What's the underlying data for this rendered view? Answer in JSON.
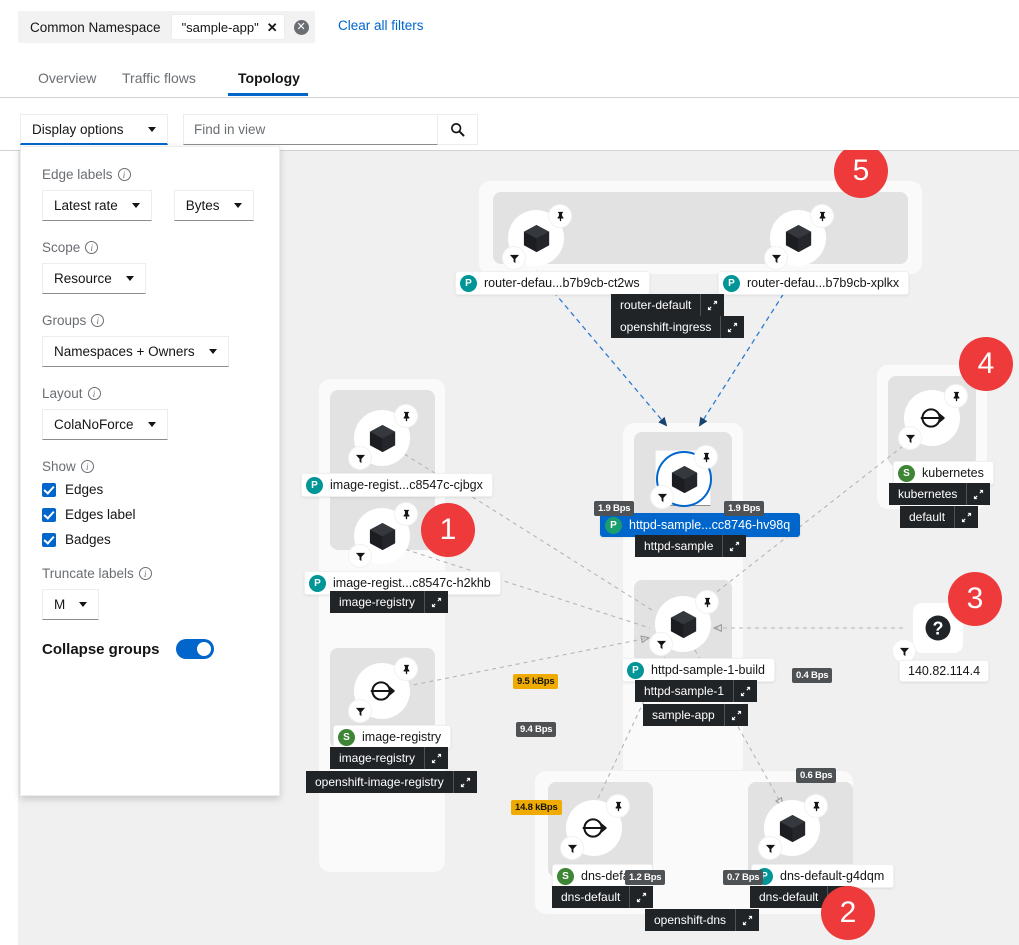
{
  "filterbar": {
    "category": "Common Namespace",
    "value": "\"sample-app\"",
    "remove_icon": "✕",
    "clear_chip_icon": "✕",
    "clear_all_label": "Clear all filters"
  },
  "tabs": [
    {
      "label": "Overview",
      "active": false
    },
    {
      "label": "Traffic flows",
      "active": false
    },
    {
      "label": "Topology",
      "active": true
    }
  ],
  "toolbar": {
    "display_options_label": "Display options",
    "search_placeholder": "Find in view",
    "search_value": "",
    "search_icon": "search-icon"
  },
  "display_panel": {
    "edge_labels": {
      "title": "Edge labels",
      "metric_select": "Latest rate",
      "unit_select": "Bytes"
    },
    "scope": {
      "title": "Scope",
      "select": "Resource"
    },
    "groups": {
      "title": "Groups",
      "select": "Namespaces + Owners"
    },
    "layout": {
      "title": "Layout",
      "select": "ColaNoForce"
    },
    "show": {
      "title": "Show",
      "items": [
        {
          "label": "Edges",
          "checked": true
        },
        {
          "label": "Edges label",
          "checked": true
        },
        {
          "label": "Badges",
          "checked": true
        }
      ]
    },
    "truncate": {
      "title": "Truncate labels",
      "select": "M"
    },
    "collapse": {
      "title": "Collapse groups",
      "enabled": true
    }
  },
  "topology": {
    "nodes": [
      {
        "id": "router-ct2ws",
        "label": "router-defau...b7b9cb-ct2ws",
        "kind": "P",
        "icon": "pod-cube-icon",
        "selected": false
      },
      {
        "id": "router-xplkx",
        "label": "router-defau...b7b9cb-xplkx",
        "kind": "P",
        "icon": "pod-cube-icon",
        "selected": false
      },
      {
        "id": "httpd-sample-pod",
        "label": "httpd-sample...cc8746-hv98q",
        "kind": "P",
        "icon": "pod-cube-icon",
        "selected": true
      },
      {
        "id": "image-registry-cjbgx",
        "label": "image-regist...c8547c-cjbgx",
        "kind": "P",
        "icon": "pod-cube-icon",
        "selected": false
      },
      {
        "id": "image-registry-h2khb",
        "label": "image-regist...c8547c-h2khb",
        "kind": "P",
        "icon": "pod-cube-icon",
        "selected": false
      },
      {
        "id": "image-registry-svc",
        "label": "image-registry",
        "kind": "S",
        "icon": "service-arrow-icon",
        "selected": false
      },
      {
        "id": "httpd-sample-1-build",
        "label": "httpd-sample-1-build",
        "kind": "P",
        "icon": "pod-cube-icon",
        "selected": false
      },
      {
        "id": "kubernetes-svc",
        "label": "kubernetes",
        "kind": "S",
        "icon": "service-arrow-icon",
        "selected": false
      },
      {
        "id": "dns-default-svc",
        "label": "dns-default",
        "kind": "S",
        "icon": "service-arrow-icon",
        "selected": false
      },
      {
        "id": "dns-default-g4dqm",
        "label": "dns-default-g4dqm",
        "kind": "P",
        "icon": "pod-cube-icon",
        "selected": false
      },
      {
        "id": "unknown-ip",
        "label": "140.82.114.4",
        "kind": "unknown",
        "icon": "question-mark-icon",
        "selected": false
      }
    ],
    "group_badges": [
      {
        "id": "router-default",
        "label": "router-default",
        "action_icon": "expand-icon"
      },
      {
        "id": "openshift-ingress",
        "label": "openshift-ingress",
        "action_icon": "expand-icon"
      },
      {
        "id": "httpd-sample",
        "label": "httpd-sample",
        "action_icon": "expand-icon"
      },
      {
        "id": "image-registry-owner",
        "label": "image-registry",
        "action_icon": "expand-icon"
      },
      {
        "id": "image-registry-owner2",
        "label": "image-registry",
        "action_icon": "expand-icon"
      },
      {
        "id": "openshift-image-registry",
        "label": "openshift-image-registry",
        "action_icon": "expand-icon"
      },
      {
        "id": "httpd-sample-1",
        "label": "httpd-sample-1",
        "action_icon": "expand-icon"
      },
      {
        "id": "sample-app",
        "label": "sample-app",
        "action_icon": "expand-icon"
      },
      {
        "id": "kubernetes-owner",
        "label": "kubernetes",
        "action_icon": "expand-icon"
      },
      {
        "id": "default-ns",
        "label": "default",
        "action_icon": "expand-icon"
      },
      {
        "id": "dns-default-owner",
        "label": "dns-default",
        "action_icon": "expand-icon"
      },
      {
        "id": "dns-default-owner2",
        "label": "dns-default",
        "action_icon": "expand-icon"
      },
      {
        "id": "openshift-dns",
        "label": "openshift-dns",
        "action_icon": "expand-icon"
      }
    ],
    "edge_labels": [
      {
        "id": "e1",
        "value": "1.9 Bps",
        "highlight": false
      },
      {
        "id": "e2",
        "value": "1.9 Bps",
        "highlight": false
      },
      {
        "id": "e3",
        "value": "9.5 kBps",
        "highlight": true
      },
      {
        "id": "e4",
        "value": "9.4 Bps",
        "highlight": false
      },
      {
        "id": "e5",
        "value": "14.8 kBps",
        "highlight": true
      },
      {
        "id": "e6",
        "value": "0.4 Bps",
        "highlight": false
      },
      {
        "id": "e7",
        "value": "0.6 Bps",
        "highlight": false
      },
      {
        "id": "e8",
        "value": "1.2 Bps",
        "highlight": false
      },
      {
        "id": "e9",
        "value": "0.7 Bps",
        "highlight": false
      }
    ],
    "annotations": [
      {
        "id": "a1",
        "number": "1"
      },
      {
        "id": "a2",
        "number": "2"
      },
      {
        "id": "a3",
        "number": "3"
      },
      {
        "id": "a4",
        "number": "4"
      },
      {
        "id": "a5",
        "number": "5"
      }
    ],
    "accent_colors": {
      "selected": "#0066cc",
      "annotation": "#ee3a3a",
      "warning_edge": "#f0ab00",
      "edge_label": "#4f5255",
      "badge": "#212427"
    }
  }
}
